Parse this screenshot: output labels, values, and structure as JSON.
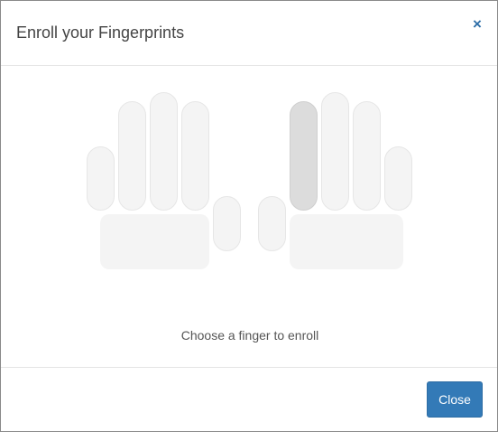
{
  "dialog": {
    "title": "Enroll your Fingerprints",
    "close_icon_glyph": "×",
    "instruction": "Choose a finger to enroll",
    "close_button_label": "Close"
  },
  "fingers": {
    "left_hand": [
      {
        "name": "left-pinky",
        "selected": false
      },
      {
        "name": "left-ring",
        "selected": false
      },
      {
        "name": "left-middle",
        "selected": false
      },
      {
        "name": "left-index",
        "selected": false
      },
      {
        "name": "left-thumb",
        "selected": false
      }
    ],
    "right_hand": [
      {
        "name": "right-thumb",
        "selected": false
      },
      {
        "name": "right-index",
        "selected": true
      },
      {
        "name": "right-middle",
        "selected": false
      },
      {
        "name": "right-ring",
        "selected": false
      },
      {
        "name": "right-pinky",
        "selected": false
      }
    ]
  },
  "colors": {
    "primary_button": "#337ab7",
    "finger_default": "#f4f4f4",
    "finger_selected": "#dcdcdc",
    "close_icon": "#2f6fa8"
  },
  "icons": {
    "close": "close-icon"
  }
}
